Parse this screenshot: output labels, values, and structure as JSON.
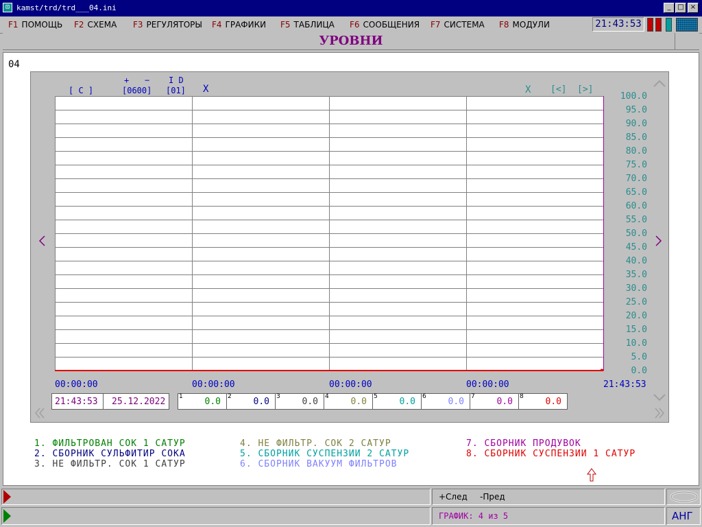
{
  "window": {
    "title": "kamst/trd/trd___04.ini"
  },
  "menu": [
    {
      "key": "F1",
      "label": "ПОМОЩЬ"
    },
    {
      "key": "F2",
      "label": "СХЕМА"
    },
    {
      "key": "F3",
      "label": "РЕГУЛЯТОРЫ"
    },
    {
      "key": "F4",
      "label": "ГРАФИКИ"
    },
    {
      "key": "F5",
      "label": "ТАБЛИЦА"
    },
    {
      "key": "F6",
      "label": "СООБЩЕНИЯ"
    },
    {
      "key": "F7",
      "label": "СИСТЕМА"
    },
    {
      "key": "F8",
      "label": "МОДУЛИ"
    }
  ],
  "clock": "21:43:53",
  "indicators": [
    "#c00000",
    "#c00000",
    "#00a0a0"
  ],
  "page_title": "УРОВНИ",
  "chart_id": "04",
  "toolbar": {
    "c_label": "[ C ]",
    "plus_label": "+",
    "minus_label": "−",
    "id_label": "I D",
    "period": "[0600]",
    "id_value": "[01]",
    "x_left": "X",
    "x_right": "X",
    "prev": "[<]",
    "next": "[>]"
  },
  "chart_data": {
    "type": "line",
    "ylim": [
      0,
      100
    ],
    "y_ticks": [
      "100.0",
      "95.0",
      "90.0",
      "85.0",
      "80.0",
      "75.0",
      "70.0",
      "65.0",
      "60.0",
      "55.0",
      "50.0",
      "45.0",
      "40.0",
      "35.0",
      "30.0",
      "25.0",
      "20.0",
      "15.0",
      "10.0",
      "5.0",
      "0.0"
    ],
    "x_ticks": [
      "00:00:00",
      "00:00:00",
      "00:00:00",
      "00:00:00",
      "21:43:53"
    ],
    "grid": true,
    "series": [
      {
        "color": "#008000",
        "values": [
          0.0
        ]
      },
      {
        "color": "#000080",
        "values": [
          0.0
        ]
      },
      {
        "color": "#404040",
        "values": [
          0.0
        ]
      },
      {
        "color": "#808040",
        "values": [
          0.0
        ]
      },
      {
        "color": "#00a0a0",
        "values": [
          0.0
        ]
      },
      {
        "color": "#8080ff",
        "values": [
          0.0
        ]
      },
      {
        "color": "#a000a0",
        "values": [
          0.0
        ]
      },
      {
        "color": "#e00000",
        "values": [
          0.0
        ]
      }
    ]
  },
  "cursor": {
    "time": "21:43:53",
    "date": "25.12.2022"
  },
  "values": [
    {
      "n": "1",
      "v": "0.0",
      "color": "#008000"
    },
    {
      "n": "2",
      "v": "0.0",
      "color": "#000080"
    },
    {
      "n": "3",
      "v": "0.0",
      "color": "#404040"
    },
    {
      "n": "4",
      "v": "0.0",
      "color": "#808040"
    },
    {
      "n": "5",
      "v": "0.0",
      "color": "#00a0a0"
    },
    {
      "n": "6",
      "v": "0.0",
      "color": "#8080ff"
    },
    {
      "n": "7",
      "v": "0.0",
      "color": "#a000a0"
    },
    {
      "n": "8",
      "v": "0.0",
      "color": "#e00000"
    }
  ],
  "legend": [
    {
      "text": "1.  ФИЛЬТРОВАН СОК 1 САТУР",
      "color": "#008000"
    },
    {
      "text": "2.  СБОРНИК СУЛЬФИТИР СОКА",
      "color": "#000080"
    },
    {
      "text": "3.  НЕ ФИЛЬТР. СОК 1 САТУР",
      "color": "#404040"
    },
    {
      "text": "4.  НЕ ФИЛЬТР. СОК 2 САТУР",
      "color": "#808040"
    },
    {
      "text": "5.  СБОРНИК СУСПЕНЗИИ 2 САТУР",
      "color": "#00a0a0"
    },
    {
      "text": "6.  СБОРНИК ВАКУУМ ФИЛЬТРОВ",
      "color": "#8080ff"
    },
    {
      "text": "7.  СБОРНИК ПРОДУВОК",
      "color": "#a000a0"
    },
    {
      "text": "8.  СБОРНИК СУСПЕНЗИИ 1 САТУР",
      "color": "#e00000"
    }
  ],
  "status": {
    "next_label": "+След",
    "prev_label": "-Пред",
    "graph_label": "ГРАФИК: 4 из 5",
    "lang": "АНГ"
  },
  "colors": {
    "title_bar": "#000080",
    "accent_purple": "#800080",
    "axis_green": "#2a8c8c",
    "baseline_red": "#e00000"
  }
}
